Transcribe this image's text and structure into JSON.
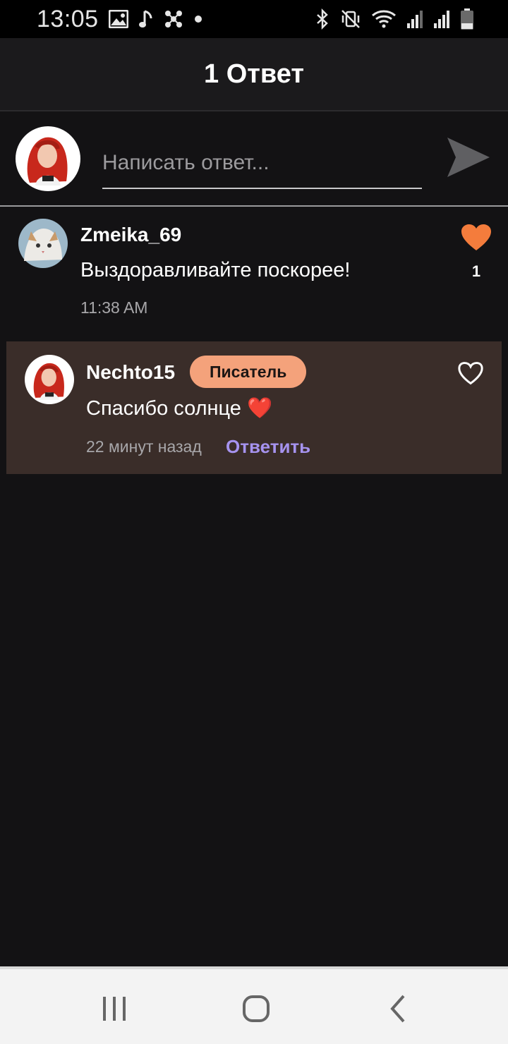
{
  "status_bar": {
    "time": "13:05",
    "left_icons": [
      "image-icon",
      "music-note-icon",
      "nodes-icon",
      "dot-icon"
    ],
    "right_icons": [
      "bluetooth-icon",
      "mute-vibrate-icon",
      "wifi-icon",
      "signal-icon",
      "signal-icon",
      "battery-icon"
    ]
  },
  "header": {
    "title": "1 Ответ"
  },
  "compose": {
    "placeholder": "Написать ответ...",
    "send_icon": "send-icon"
  },
  "comment": {
    "username": "Zmeika_69",
    "text": "Выздоравливайте поскорее!",
    "time": "11:38 AM",
    "likes": "1",
    "liked": true,
    "like_color": "#f47c3c"
  },
  "reply": {
    "username": "Nechto15",
    "badge": "Писатель",
    "text": "Спасибо солнце ❤️",
    "time": "22 минут назад",
    "reply_label": "Ответить",
    "liked": false
  },
  "colors": {
    "background": "#131214",
    "header": "#1b1a1c",
    "reply_card": "#3a2d29",
    "badge": "#f4a27b",
    "accent_link": "#a693ef"
  },
  "nav_bar": {
    "icons": [
      "recents-icon",
      "home-icon",
      "back-icon"
    ]
  }
}
